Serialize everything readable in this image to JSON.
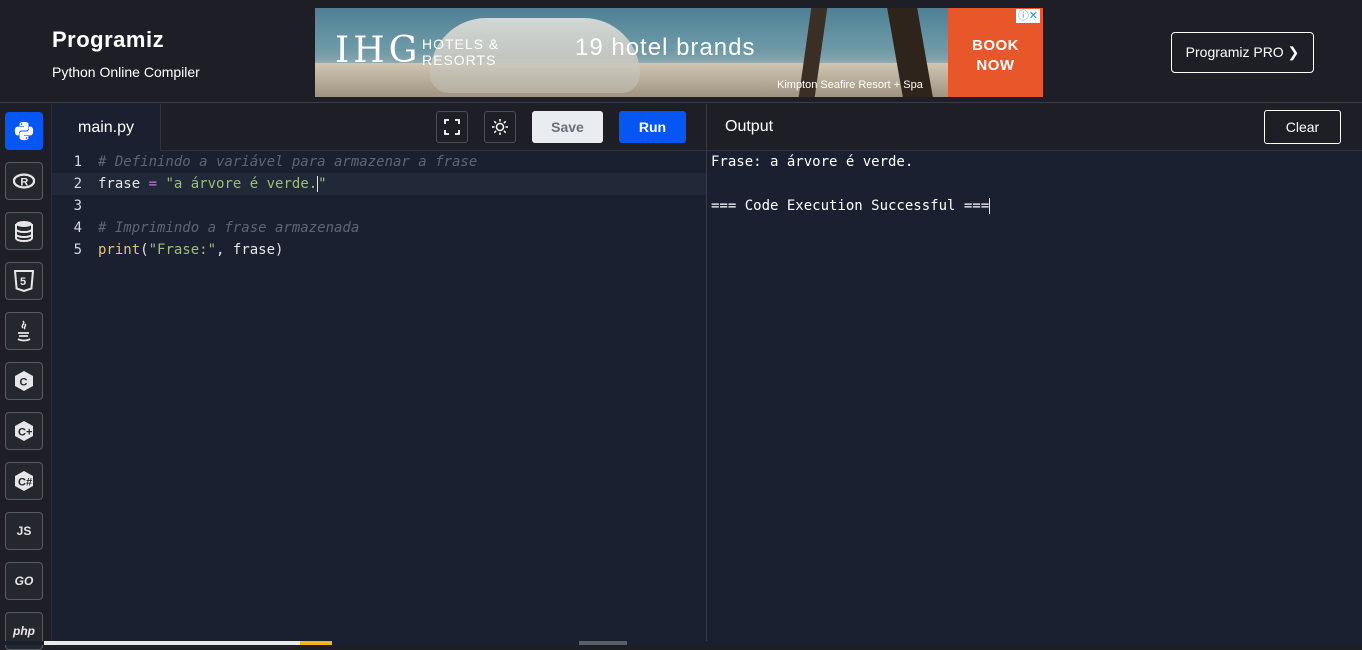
{
  "header": {
    "logo_text": "Programiz",
    "subtitle": "Python Online Compiler",
    "pro_button": "Programiz PRO ❯"
  },
  "ad": {
    "brand": "IHG",
    "brand_sub_1": "HOTELS &",
    "brand_sub_2": "RESORTS",
    "headline": "19 hotel brands",
    "caption": "Kimpton Seafire Resort + Spa",
    "cta_1": "BOOK",
    "cta_2": "NOW",
    "adchoices_icon": "info-icon"
  },
  "sidebar": {
    "items": [
      {
        "name": "python",
        "label": "",
        "icon": "python-icon",
        "active": true
      },
      {
        "name": "r",
        "label": "R",
        "icon": "r-icon"
      },
      {
        "name": "sql",
        "label": "",
        "icon": "database-icon"
      },
      {
        "name": "html",
        "label": "5",
        "icon": "html5-icon"
      },
      {
        "name": "java",
        "label": "",
        "icon": "java-icon"
      },
      {
        "name": "c",
        "label": "C",
        "icon": "c-icon"
      },
      {
        "name": "cpp",
        "label": "C",
        "icon": "cpp-icon"
      },
      {
        "name": "csharp",
        "label": "C",
        "icon": "csharp-icon"
      },
      {
        "name": "js",
        "label": "JS",
        "icon": "js-icon"
      },
      {
        "name": "go",
        "label": "GO",
        "icon": "go-icon"
      },
      {
        "name": "php",
        "label": "php",
        "icon": "php-icon"
      }
    ]
  },
  "editor": {
    "file_tab": "main.py",
    "save_label": "Save",
    "run_label": "Run",
    "fullscreen_icon": "fullscreen-icon",
    "theme_icon": "sun-icon",
    "lines": [
      {
        "num": "1",
        "comment": "# Definindo a variável para armazenar a frase"
      },
      {
        "num": "2",
        "var": "frase",
        "op": " = ",
        "str": "\"a árvore é verde.",
        "str_end": "\""
      },
      {
        "num": "3"
      },
      {
        "num": "4",
        "comment": "# Imprimindo a frase armazenada"
      },
      {
        "num": "5",
        "fn": "print",
        "open": "(",
        "str": "\"Frase:\"",
        "rest": ", frase)"
      }
    ]
  },
  "output": {
    "title": "Output",
    "clear_label": "Clear",
    "lines": [
      "Frase: a árvore é verde.",
      "",
      "=== Code Execution Successful ==="
    ]
  }
}
